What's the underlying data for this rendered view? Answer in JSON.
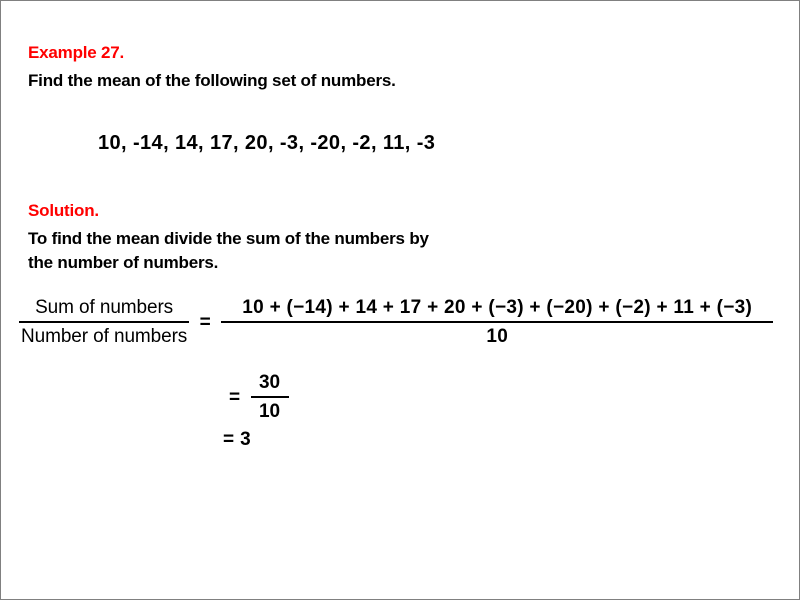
{
  "colors": {
    "heading": "#FF0000",
    "text": "#000000",
    "background": "#FFFFFF",
    "border": "#808080"
  },
  "problem": {
    "label": "Example 27.",
    "instruction": "Find the mean of the following set of numbers.",
    "numbers_text": "10, -14, 14, 17, 20, -3, -20, -2, 11, -3",
    "numbers": [
      10,
      -14,
      14,
      17,
      20,
      -3,
      -20,
      -2,
      11,
      -3
    ]
  },
  "solution": {
    "label": "Solution.",
    "explanation_line_1": "To find the mean divide the sum of the numbers by",
    "explanation_line_2": "the number of numbers.",
    "formula": {
      "numerator_label": "Sum of numbers",
      "denominator_label": "Number of numbers"
    },
    "equals_sign": "=",
    "step_1": {
      "numerator": "10 + (−14) + 14 + 17 + 20 + (−3) + (−20) + (−2) + 11 + (−3)",
      "denominator": "10"
    },
    "step_2": {
      "numerator": "30",
      "denominator": "10"
    },
    "step_3": {
      "result": "3"
    }
  }
}
